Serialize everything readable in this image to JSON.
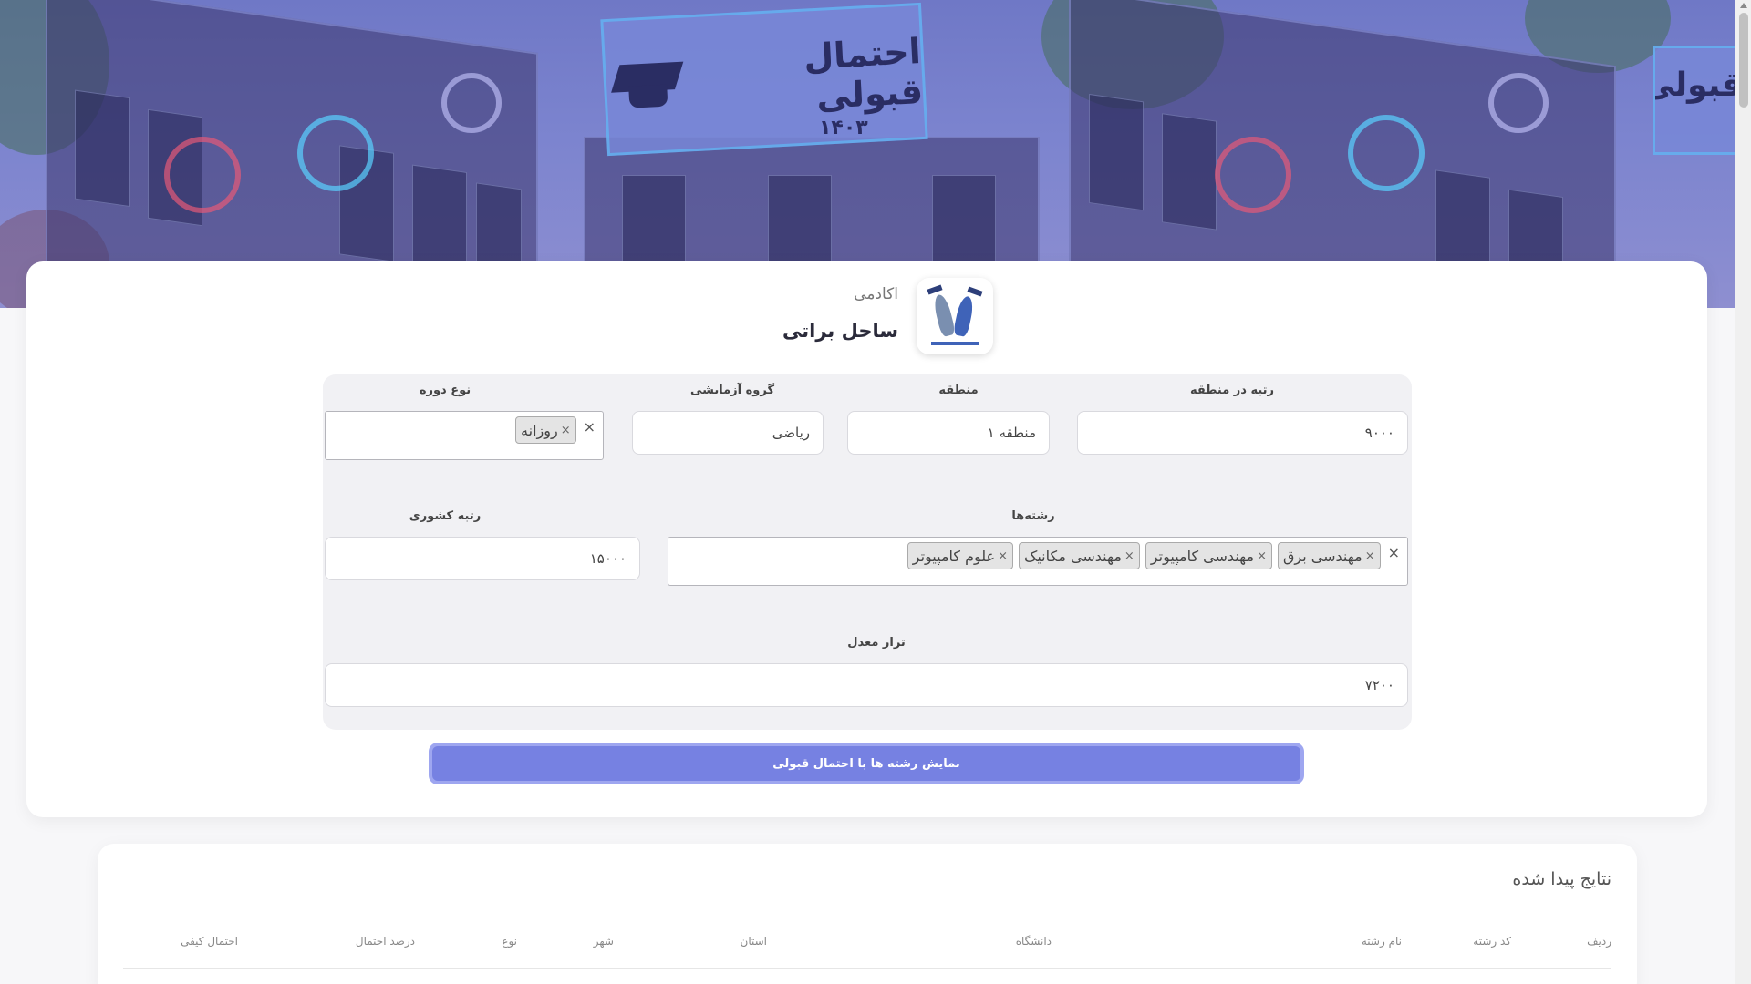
{
  "hero": {
    "sign_text": "احتمال قبولی",
    "sign_year": "۱۴۰۳",
    "sign_text_right": "قبولی"
  },
  "brand": {
    "subtitle": "اکادمی",
    "name": "ساحل براتی"
  },
  "form": {
    "rank_region_label": "رتبه در منطقه",
    "rank_region_value": "۹۰۰۰",
    "region_label": "منطقه",
    "region_value": "منطقه ۱",
    "exam_group_label": "گروه آزمایشی",
    "exam_group_value": "ریاضی",
    "course_type_label": "نوع دوره",
    "course_type_chips": [
      "روزانه"
    ],
    "majors_label": "رشته‌ها",
    "majors_chips": [
      "مهندسی برق",
      "مهندسی کامپیوتر",
      "مهندسی مکانیک",
      "علوم کامپیوتر"
    ],
    "national_rank_label": "رتبه کشوری",
    "national_rank_value": "۱۵۰۰۰",
    "gpa_score_label": "تراز معدل",
    "gpa_score_value": "۷۲۰۰",
    "chip_remove": "×",
    "clear_all": "×"
  },
  "submit_label": "نمایش رشته ها با احتمال قبولی",
  "results": {
    "title": "نتایج پیدا شده",
    "columns": [
      "ردیف",
      "کد رشته",
      "نام رشته",
      "دانشگاه",
      "استان",
      "شهر",
      "نوع",
      "درصد احتمال",
      "احتمال کیفی"
    ]
  },
  "colors": {
    "accent": "#7681e2",
    "hero": "#7c84cf"
  }
}
